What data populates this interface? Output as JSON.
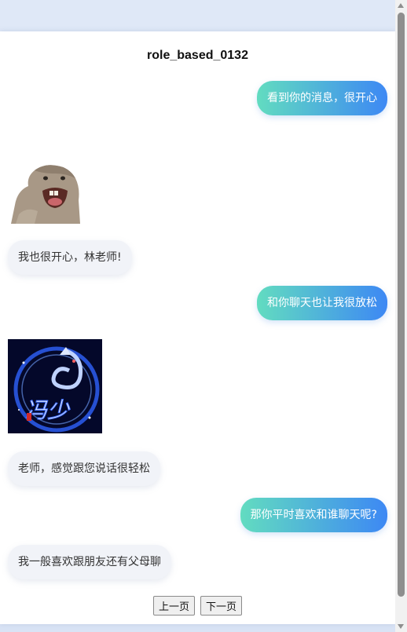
{
  "page": {
    "title": "role_based_0132"
  },
  "messages": [
    {
      "side": "right",
      "type": "text",
      "text": "看到你的消息，很开心"
    },
    {
      "side": "left",
      "type": "sticker",
      "sticker": "groundhog-sticker"
    },
    {
      "side": "left",
      "type": "text",
      "text": "我也很开心，林老师!"
    },
    {
      "side": "right",
      "type": "text",
      "text": "和你聊天也让我很放松"
    },
    {
      "side": "left",
      "type": "sticker",
      "sticker": "dragon-sticker",
      "sticker_text": "冯少"
    },
    {
      "side": "left",
      "type": "text",
      "text": "老师，感觉跟您说话很轻松"
    },
    {
      "side": "right",
      "type": "text",
      "text": "那你平时喜欢和谁聊天呢?"
    },
    {
      "side": "left",
      "type": "text",
      "text": "我一般喜欢跟朋友还有父母聊"
    }
  ],
  "pager": {
    "prev_label": "上一页",
    "next_label": "下一页"
  },
  "colors": {
    "gradient_start": "#62dcc0",
    "gradient_end": "#3d88f4",
    "left_bubble": "#f1f3f8"
  }
}
